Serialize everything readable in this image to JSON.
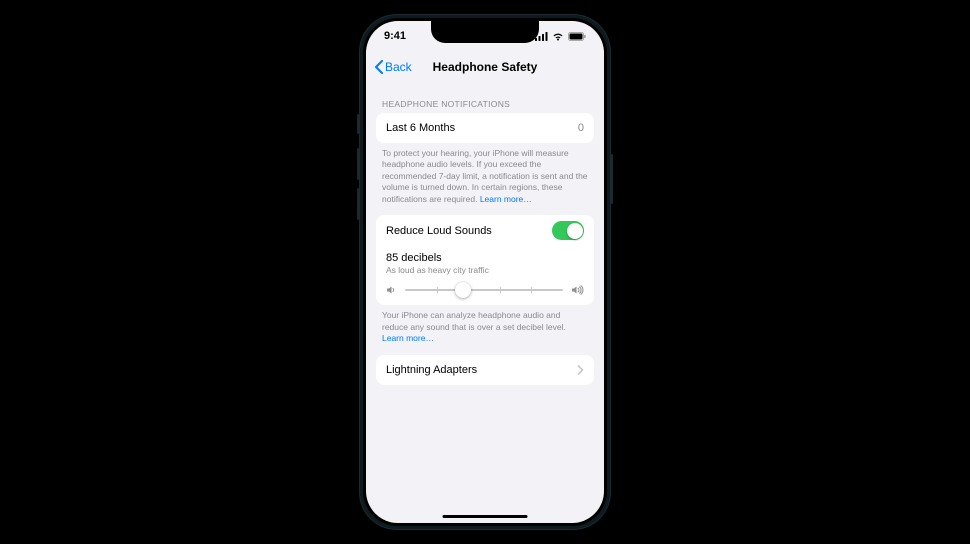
{
  "status": {
    "time": "9:41"
  },
  "nav": {
    "back_label": "Back",
    "title": "Headphone Safety"
  },
  "sections": {
    "notifications": {
      "header": "HEADPHONE NOTIFICATIONS",
      "row": {
        "label": "Last 6 Months",
        "value": "0"
      },
      "footer_text": "To protect your hearing, your iPhone will measure headphone audio levels. If you exceed the recommended 7-day limit, a notification is sent and the volume is turned down. In certain regions, these notifications are required. ",
      "footer_link": "Learn more…"
    },
    "reduce": {
      "toggle_label": "Reduce Loud Sounds",
      "toggle_on": true,
      "db_label": "85 decibels",
      "db_desc": "As loud as heavy city traffic",
      "slider_percent": 37,
      "footer_text": "Your iPhone can analyze headphone audio and reduce any sound that is over a set decibel level. ",
      "footer_link": "Learn more…"
    },
    "adapters": {
      "label": "Lightning Adapters"
    }
  }
}
